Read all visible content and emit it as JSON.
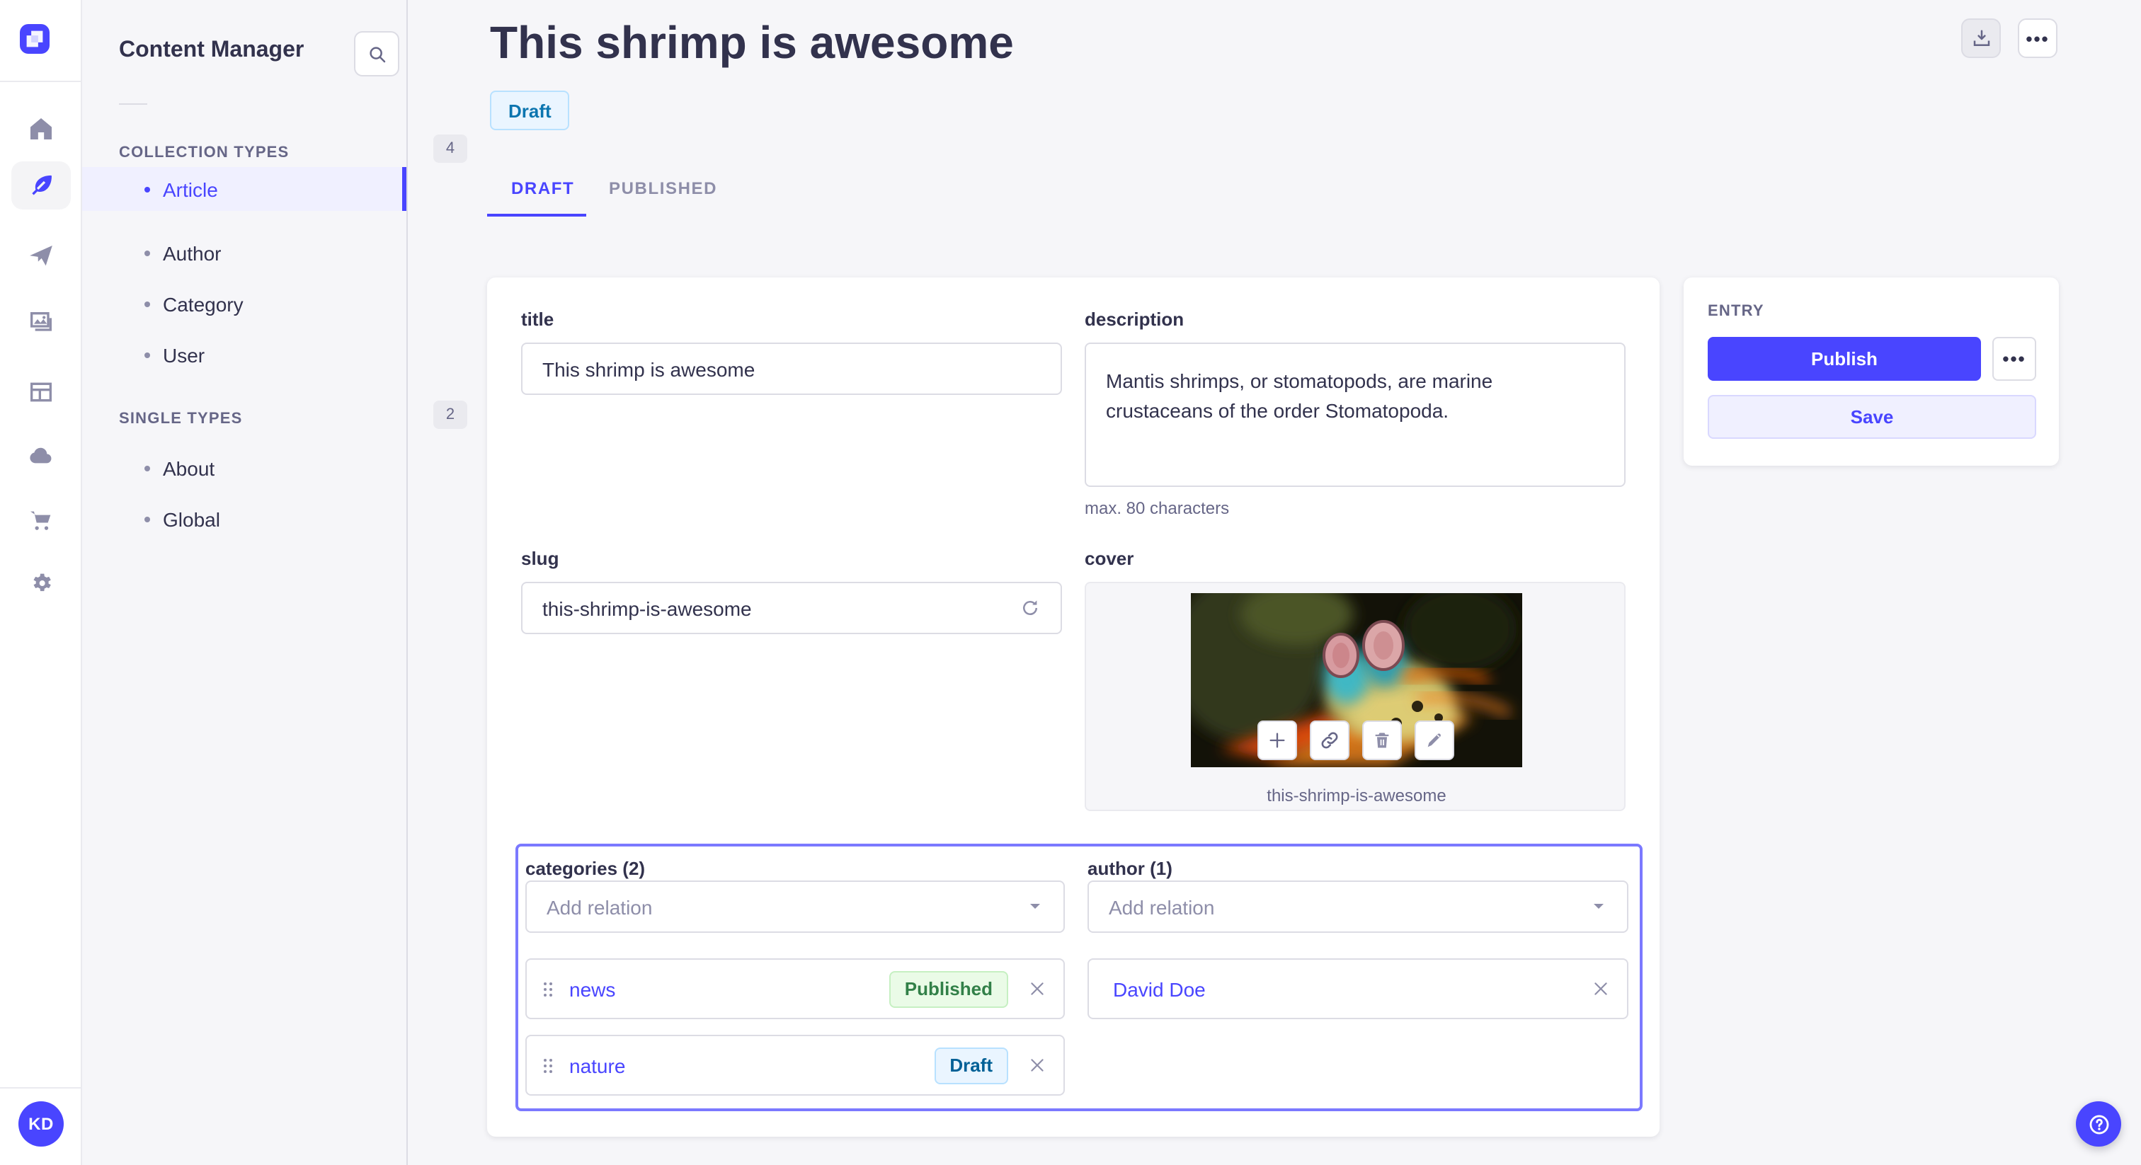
{
  "colors": {
    "accent": "#4945ff",
    "accent_light": "#7b79ff",
    "neutral_bg": "#f6f6f9",
    "success": "#328048",
    "draft_blue": "#0c75af"
  },
  "sidebar": {
    "nav": [
      {
        "name": "home"
      },
      {
        "name": "content-manager",
        "active": true
      },
      {
        "name": "send"
      },
      {
        "name": "media-library"
      },
      {
        "name": "content-builder"
      },
      {
        "name": "cloud"
      },
      {
        "name": "marketplace"
      },
      {
        "name": "settings"
      }
    ],
    "avatar_initials": "KD"
  },
  "panel": {
    "title": "Content Manager",
    "sections": [
      {
        "label": "COLLECTION TYPES",
        "count": "4",
        "items": [
          {
            "label": "Article",
            "active": true
          },
          {
            "label": "Author"
          },
          {
            "label": "Category"
          },
          {
            "label": "User"
          }
        ]
      },
      {
        "label": "SINGLE TYPES",
        "count": "2",
        "items": [
          {
            "label": "About"
          },
          {
            "label": "Global"
          }
        ]
      }
    ]
  },
  "header": {
    "title": "This shrimp is awesome",
    "status": "Draft",
    "tabs": [
      {
        "label": "DRAFT",
        "active": true
      },
      {
        "label": "PUBLISHED"
      }
    ],
    "more_dots": "•••"
  },
  "form": {
    "title": {
      "label": "title",
      "value": "This shrimp is awesome"
    },
    "description": {
      "label": "description",
      "value": "Mantis shrimps, or stomatopods, are marine crustaceans of the order Stomatopoda.",
      "helper": "max. 80 characters"
    },
    "slug": {
      "label": "slug",
      "value": "this-shrimp-is-awesome"
    },
    "cover": {
      "label": "cover",
      "filename": "this-shrimp-is-awesome"
    },
    "categories": {
      "label": "categories (2)",
      "placeholder": "Add relation",
      "items": [
        {
          "name": "news",
          "status": "Published"
        },
        {
          "name": "nature",
          "status": "Draft"
        }
      ]
    },
    "author": {
      "label": "author (1)",
      "placeholder": "Add relation",
      "items": [
        {
          "name": "David Doe"
        }
      ]
    }
  },
  "entry": {
    "label": "ENTRY",
    "publish": "Publish",
    "save": "Save",
    "more_dots": "•••"
  }
}
